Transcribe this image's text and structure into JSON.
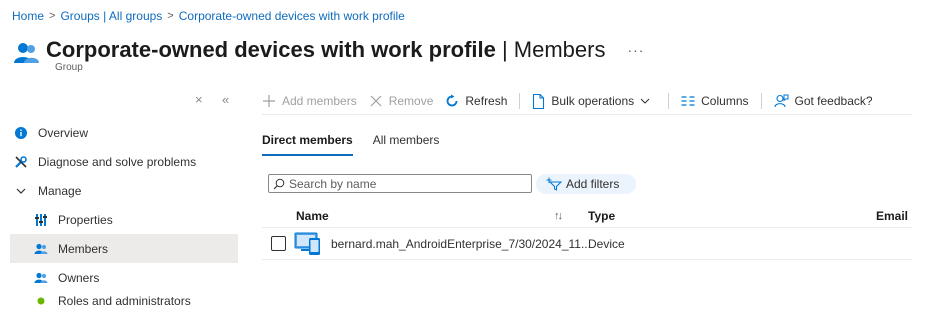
{
  "breadcrumb": {
    "items": [
      "Home",
      "Groups | All groups",
      "Corporate-owned devices with work profile"
    ]
  },
  "header": {
    "title": "Corporate-owned devices with work profile",
    "title_suffix": " | Members",
    "subtitle": "Group",
    "more": "···"
  },
  "sidebar_controls": {
    "close": "×",
    "collapse": "«"
  },
  "sidebar": {
    "items": [
      {
        "label": "Overview",
        "icon": "info-icon"
      },
      {
        "label": "Diagnose and solve problems",
        "icon": "wrench-icon"
      },
      {
        "label": "Manage",
        "icon": "chevron-down-icon"
      },
      {
        "label": "Properties",
        "icon": "properties-icon"
      },
      {
        "label": "Members",
        "icon": "members-icon",
        "selected": true
      },
      {
        "label": "Owners",
        "icon": "owners-icon"
      },
      {
        "label": "Roles and administrators",
        "icon": "roles-icon"
      }
    ]
  },
  "toolbar": {
    "add_members": "Add members",
    "remove": "Remove",
    "refresh": "Refresh",
    "bulk_operations": "Bulk operations",
    "columns": "Columns",
    "feedback": "Got feedback?"
  },
  "tabs": [
    "Direct members",
    "All members"
  ],
  "search": {
    "placeholder": "Search by name",
    "value": ""
  },
  "filters": {
    "label": "Add filters"
  },
  "table": {
    "headers": {
      "name": "Name",
      "type": "Type",
      "email": "Email"
    },
    "sort_indicator": "↑↓",
    "rows": [
      {
        "name": "bernard.mah_AndroidEnterprise_7/30/2024_11...",
        "type": "Device"
      }
    ]
  },
  "colors": {
    "accent": "#0f6cbd",
    "selected_nav": "#edebe9",
    "filter_pill": "#ebf3fc"
  }
}
